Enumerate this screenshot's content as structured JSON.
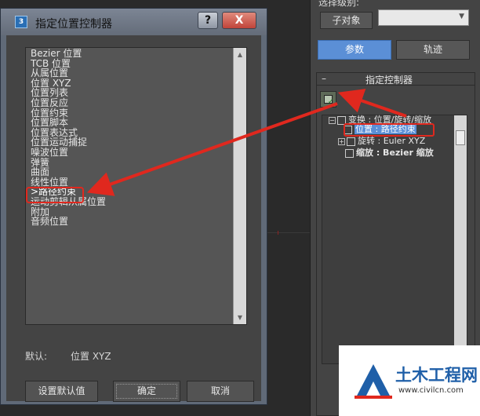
{
  "dialog": {
    "title": "指定位置控制器",
    "icon_text": "3",
    "help_label": "?",
    "close_label": "X",
    "controllers": [
      "Bezier 位置",
      "TCB 位置",
      "从属位置",
      "位置 XYZ",
      "位置列表",
      "位置反应",
      "位置约束",
      "位置脚本",
      "位置表达式",
      "位置运动捕捉",
      "噪波位置",
      "弹簧",
      "曲面",
      "线性位置",
      ">路径约束",
      "运动剪辑从属位置",
      "附加",
      "音频位置"
    ],
    "selected_index": 14,
    "default_label": "默认:",
    "default_value": "位置 XYZ",
    "buttons": {
      "set_default": "设置默认值",
      "ok": "确定",
      "cancel": "取消"
    }
  },
  "panel": {
    "cut_label": "选择级别:",
    "sub_object_button": "子对象",
    "tabs": {
      "params": "参数",
      "track": "轨迹"
    },
    "rollout_title": "指定控制器",
    "rollout_toggle": "–",
    "tree": {
      "root": "变换 : 位置/旋转/缩放",
      "position": "位置 : 路径约束",
      "rotation": "旋转 : Euler XYZ",
      "scale": "缩放 : Bezier 缩放"
    }
  },
  "watermark": {
    "name": "土木工程网",
    "url": "www.civilcn.com"
  },
  "colors": {
    "highlight_box": "#e0281e",
    "accent_blue": "#5b8fd6"
  }
}
